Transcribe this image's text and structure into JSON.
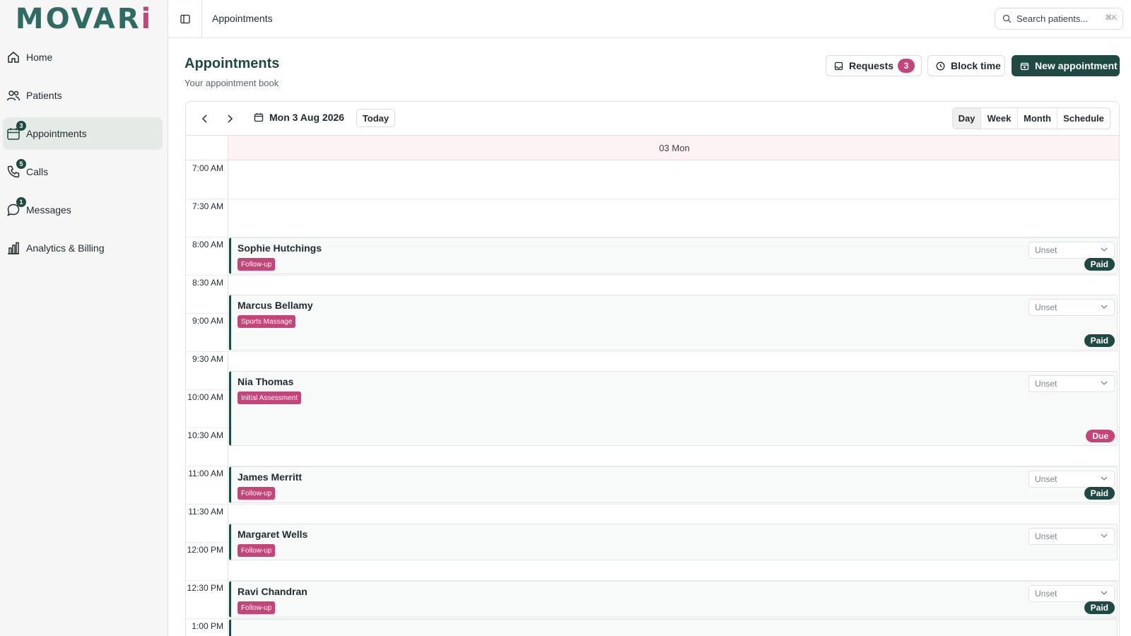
{
  "logo": {
    "pre": "MOVAR",
    "dot": "i"
  },
  "sidebar": {
    "items": [
      {
        "label": "Home",
        "icon": "home-icon",
        "badge": null
      },
      {
        "label": "Patients",
        "icon": "users-icon",
        "badge": null
      },
      {
        "label": "Appointments",
        "icon": "calendar-icon",
        "badge": "3"
      },
      {
        "label": "Calls",
        "icon": "phone-icon",
        "badge": "5"
      },
      {
        "label": "Messages",
        "icon": "message-icon",
        "badge": "1"
      },
      {
        "label": "Analytics & Billing",
        "icon": "bar-chart-icon",
        "badge": null
      }
    ]
  },
  "topbar": {
    "breadcrumb": "Appointments",
    "search_placeholder": "Search patients...",
    "search_shortcut": "⌘K"
  },
  "page": {
    "title": "Appointments",
    "subtitle": "Your appointment book"
  },
  "actions": {
    "requests_label": "Requests",
    "requests_count": "3",
    "block_time_label": "Block time",
    "new_appointment_label": "New appointment"
  },
  "calendar": {
    "date_label": "Mon 3 Aug 2026",
    "today_label": "Today",
    "views": [
      "Day",
      "Week",
      "Month",
      "Schedule"
    ],
    "active_view": "Day",
    "day_header": "03 Mon",
    "time_slots": [
      "7:00 AM",
      "7:30 AM",
      "8:00 AM",
      "8:30 AM",
      "9:00 AM",
      "9:30 AM",
      "10:00 AM",
      "10:30 AM",
      "11:00 AM",
      "11:30 AM",
      "12:00 PM",
      "12:30 PM",
      "1:00 PM"
    ],
    "appointments": [
      {
        "name": "Sophie Hutchings",
        "type": "Follow-up",
        "status": "Unset",
        "payment": "Paid",
        "start": "8:00 AM",
        "end": "8:30 AM"
      },
      {
        "name": "Marcus Bellamy",
        "type": "Sports Massage",
        "status": "Unset",
        "payment": "Paid",
        "start": "8:45 AM",
        "end": "9:30 AM"
      },
      {
        "name": "Nia Thomas",
        "type": "Initial Assessment",
        "status": "Unset",
        "payment": "Due",
        "start": "9:45 AM",
        "end": "10:45 AM"
      },
      {
        "name": "James Merritt",
        "type": "Follow-up",
        "status": "Unset",
        "payment": "Paid",
        "start": "11:00 AM",
        "end": "11:30 AM"
      },
      {
        "name": "Margaret Wells",
        "type": "Follow-up",
        "status": "Unset",
        "payment": null,
        "start": "11:45 AM",
        "end": "12:15 PM"
      },
      {
        "name": "Ravi Chandran",
        "type": "Follow-up",
        "status": "Unset",
        "payment": "Paid",
        "start": "12:30 PM",
        "end": "1:00 PM"
      }
    ],
    "trailing_block_start": "1:00 PM"
  },
  "colors": {
    "brand": "#1f4a43",
    "accent": "#c4457a",
    "active_nav": "#e4ebe7",
    "day_header_bg": "#fdf3f5"
  }
}
